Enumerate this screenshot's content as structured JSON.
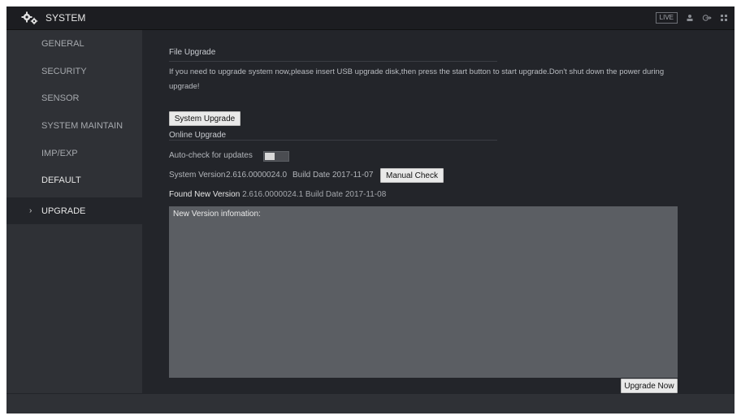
{
  "header": {
    "title": "SYSTEM",
    "live_label": "LIVE",
    "icons": [
      "gear-icon",
      "user-icon",
      "logout-icon",
      "grid-icon"
    ]
  },
  "sidebar": {
    "items": [
      {
        "label": "GENERAL"
      },
      {
        "label": "SECURITY"
      },
      {
        "label": "SENSOR"
      },
      {
        "label": "SYSTEM MAINTAIN"
      },
      {
        "label": "IMP/EXP"
      },
      {
        "label": "DEFAULT"
      },
      {
        "label": "UPGRADE"
      }
    ],
    "active_chevron": "›"
  },
  "file_upgrade": {
    "title": "File Upgrade",
    "instructions": "If you need to upgrade system now,please insert USB upgrade disk,then press the start button to start upgrade.Don't shut down the power during upgrade!",
    "button": "System Upgrade"
  },
  "online_upgrade": {
    "title": "Online Upgrade",
    "auto_check_label": "Auto-check for updates",
    "system_version_label": "System Version",
    "system_version": "2.616.0000024.0",
    "build_date_label": "Build Date",
    "build_date": "2017-11-07",
    "manual_check_button": "Manual Check",
    "found_label": "Found New Version",
    "found_version": "2.616.0000024.1",
    "found_build_date_label": "Build Date",
    "found_build_date": "2017-11-08",
    "info_label": "New Version infomation:",
    "upgrade_now_button": "Upgrade Now"
  },
  "colors": {
    "background": "#23252a",
    "sidebar": "#2f3136",
    "topbar": "#1c1d21",
    "info_box": "#5b5e63",
    "button": "#e9e9e9"
  }
}
